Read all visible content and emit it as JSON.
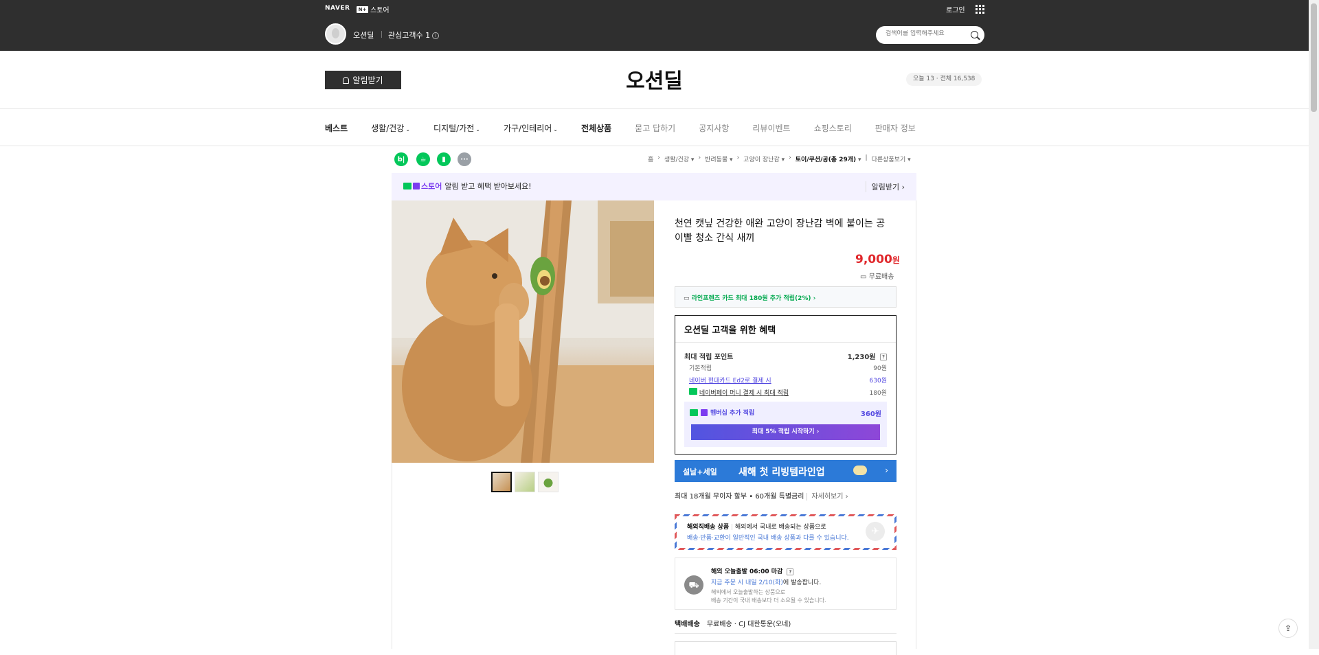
{
  "gnb": {
    "logo": "NAVER",
    "store_badge": "N+",
    "store_label": "스토어",
    "login": "로그인"
  },
  "store": {
    "name": "오션딜",
    "fav_label": "관심고객수 1",
    "title": "오션딜",
    "alarm_button": "알림받기",
    "visits": "오늘 13 · 전체 16,538"
  },
  "search": {
    "placeholder": "검색어를 입력해주세요"
  },
  "nav": [
    "베스트",
    "생활/건강",
    "디지털/가전",
    "가구/인테리어",
    "전체상품",
    "묻고 답하기",
    "공지사항",
    "리뷰이벤트",
    "쇼핑스토리",
    "판매자 정보"
  ],
  "share_buttons": {
    "blog": "b|",
    "cafe": "☕",
    "bookmark": "▮",
    "more": "···"
  },
  "breadcrumb": {
    "home": "홈",
    "c1": "생활/건강",
    "c2": "반려동물",
    "c3": "고양이 장난감",
    "current": "토이/쿠션/공(총 29개)",
    "other": "다른상품보기"
  },
  "promo": {
    "store_label": "스토어",
    "text": "알림 받고 혜택 받아보세요!",
    "action": "알림받기 ›"
  },
  "product": {
    "title": "천연 캣닢 건강한 애완 고양이 장난감 벽에 붙이는 공 이빨 청소 간식 새끼",
    "price": "9,000",
    "price_unit": "원",
    "shipping": "무료배송",
    "card_promo": "라인프렌즈 카드 최대 180원 추가 적립(2%) ›"
  },
  "benefit": {
    "title": "오션딜 고객을 위한 혜택",
    "max_label": "최대 적립 포인트",
    "max_value": "1,230원",
    "basic_label": "기본적립",
    "basic_value": "90원",
    "hyundai_label": "네이버 현대카드 Ed2로 결제 시",
    "hyundai_value": "630원",
    "pay_label": "네이버페이 머니 결제 시 최대 적립",
    "pay_value": "180원",
    "member_label": "멤버십 추가 적립",
    "member_value": "360원",
    "member_button": "최대 5% 적립 시작하기 ›"
  },
  "sale_banner": {
    "left": "설날+세일",
    "center": "새해 첫 리빙템라인업",
    "arrow": "›"
  },
  "installment": {
    "text": "최대 18개월 무이자 할부 • 60개월 특별금리",
    "more": "자세히보기 ›"
  },
  "overseas": {
    "title": "해외직배송 상품",
    "desc": "해외에서 국내로 배송되는 상품으로",
    "note": "배송·반품·교환이 일반적인 국내 배송 상품과 다를 수 있습니다."
  },
  "delivery": {
    "title": "해외 오늘출발 06:00 마감",
    "eta_pre": "지금 주문 시 내일 2/10(화)",
    "eta_post": "에 발송합니다.",
    "note1": "해외에서 오늘출발하는 상품으로",
    "note2": "배송 기간이 국내 배송보다 더 소요될 수 있습니다."
  },
  "courier": {
    "label": "택배배송",
    "value": "무료배송 · CJ 대한통운(오네)"
  },
  "colors": {
    "accent": "#7b3cf0",
    "price": "#e0272b",
    "green": "#03c75a",
    "topbar": "#2f2f2f"
  }
}
